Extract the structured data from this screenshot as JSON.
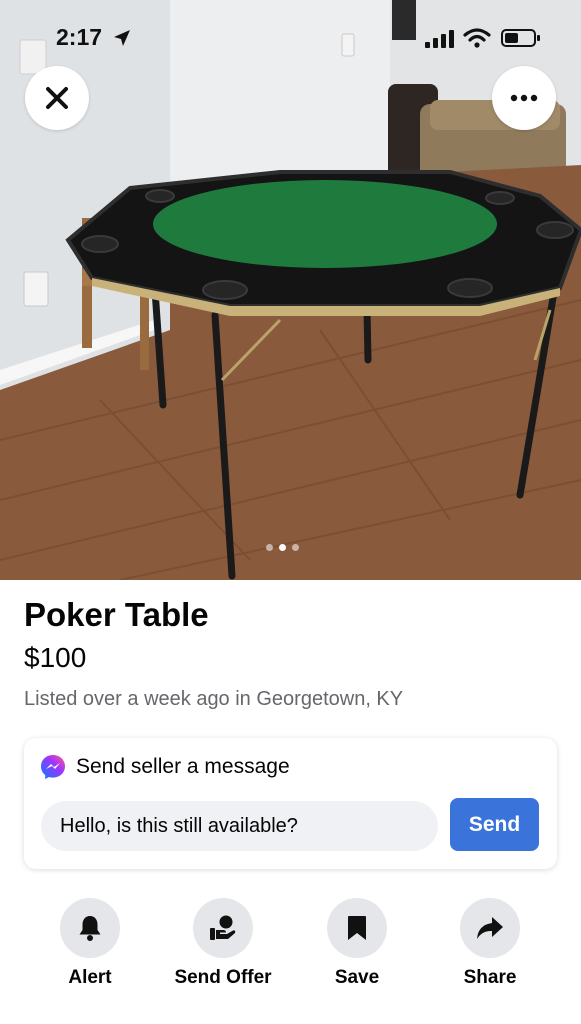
{
  "status_bar": {
    "time": "2:17"
  },
  "photo": {
    "image_count": 3,
    "active_index": 1
  },
  "listing": {
    "title": "Poker Table",
    "price": "$100",
    "meta": "Listed over a week ago in Georgetown, KY"
  },
  "message": {
    "header": "Send seller a message",
    "input_value": "Hello, is this still available?",
    "send_label": "Send"
  },
  "actions": [
    {
      "label": "Alert",
      "icon": "bell-icon"
    },
    {
      "label": "Send Offer",
      "icon": "offer-hand-icon"
    },
    {
      "label": "Save",
      "icon": "bookmark-icon"
    },
    {
      "label": "Share",
      "icon": "share-arrow-icon"
    }
  ],
  "colors": {
    "accent": "#3a74db",
    "felt": "#1f7a3e",
    "floor": "#8a5a3c"
  }
}
